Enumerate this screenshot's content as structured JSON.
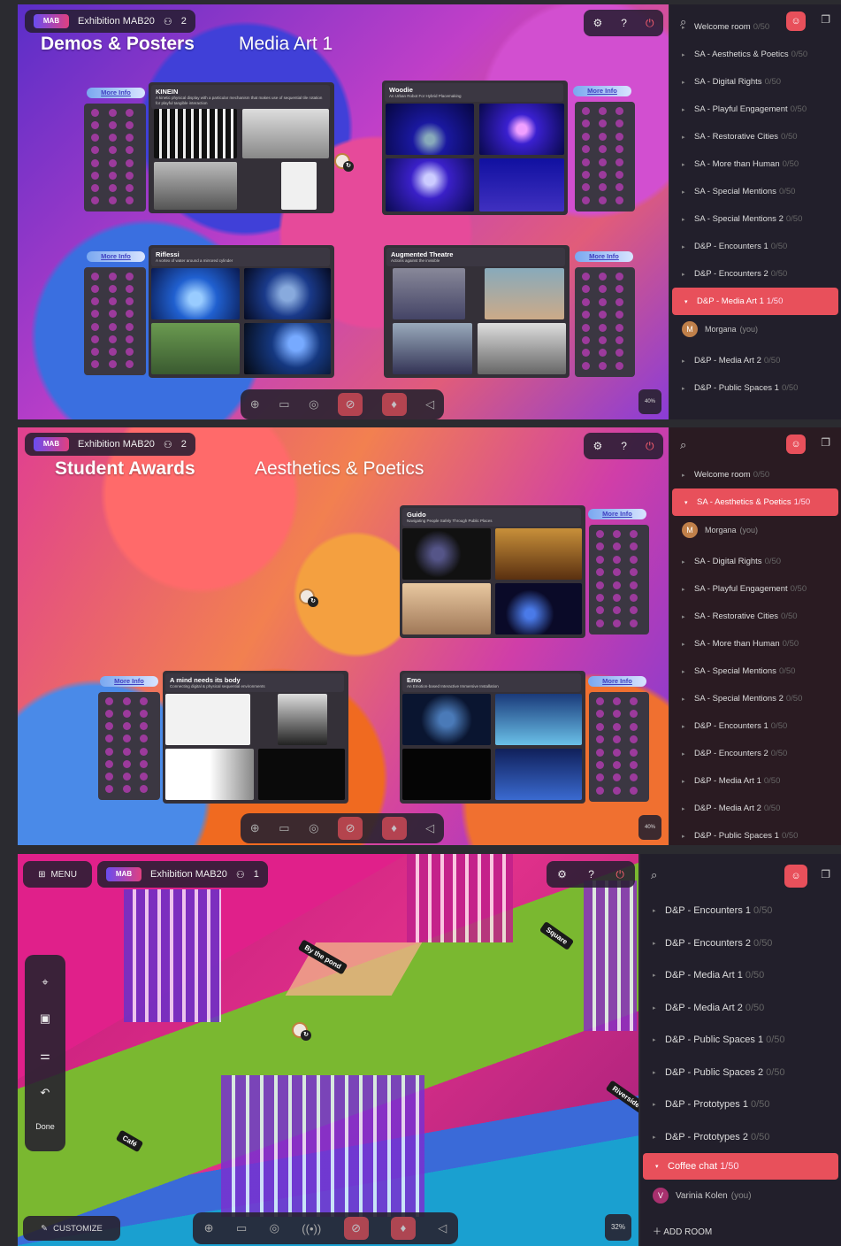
{
  "colors": {
    "accent": "#e8505b",
    "panel": "#221f2b"
  },
  "exhibition": "Exhibition MAB20",
  "logo_text": "MAB",
  "frame1": {
    "users": "2",
    "title": "Demos & Posters",
    "room": "Media Art 1",
    "zoom": "40%",
    "posters": [
      {
        "title": "KINEIN",
        "subtitle": "A kinetic physical display with a particular mechanism that makes use of sequential tile rotation for playful tangible interaction",
        "more": "More Info"
      },
      {
        "title": "Woodie",
        "subtitle": "An Urban Robot For Hybrid Placemaking",
        "more": "More Info"
      },
      {
        "title": "Riflessi",
        "subtitle": "A vortex of water around a mirrored cylinder",
        "more": "More Info"
      },
      {
        "title": "Augmented Theatre",
        "subtitle": "Actions against the invisible",
        "more": "More Info"
      }
    ],
    "rooms": [
      {
        "name": "Welcome room",
        "count": "0/50"
      },
      {
        "name": "SA - Aesthetics & Poetics",
        "count": "0/50"
      },
      {
        "name": "SA - Digital Rights",
        "count": "0/50"
      },
      {
        "name": "SA - Playful Engagement",
        "count": "0/50"
      },
      {
        "name": "SA - Restorative Cities",
        "count": "0/50"
      },
      {
        "name": "SA - More than Human",
        "count": "0/50"
      },
      {
        "name": "SA - Special Mentions",
        "count": "0/50"
      },
      {
        "name": "SA - Special Mentions 2",
        "count": "0/50"
      },
      {
        "name": "D&P - Encounters 1",
        "count": "0/50"
      },
      {
        "name": "D&P - Encounters 2",
        "count": "0/50"
      },
      {
        "name": "D&P - Media Art 1",
        "count": "1/50"
      },
      {
        "name": "D&P - Media Art 2",
        "count": "0/50"
      },
      {
        "name": "D&P - Public Spaces 1",
        "count": "0/50"
      }
    ],
    "user": {
      "initial": "M",
      "name": "Morgana",
      "you": "(you)"
    }
  },
  "frame2": {
    "users": "2",
    "title": "Student Awards",
    "room": "Aesthetics & Poetics",
    "zoom": "40%",
    "posters": [
      {
        "title": "Guido",
        "subtitle": "Navigating People Safely Through Public Places",
        "more": "More Info"
      },
      {
        "title": "A mind needs its body",
        "subtitle": "Connecting digital & physical sequential environments",
        "more": "More Info"
      },
      {
        "title": "Emo",
        "subtitle": "An Emotion-based Interactive Immersive Installation",
        "more": "More Info"
      }
    ],
    "rooms": [
      {
        "name": "Welcome room",
        "count": "0/50"
      },
      {
        "name": "SA - Aesthetics & Poetics",
        "count": "1/50"
      },
      {
        "name": "SA - Digital Rights",
        "count": "0/50"
      },
      {
        "name": "SA - Playful Engagement",
        "count": "0/50"
      },
      {
        "name": "SA - Restorative Cities",
        "count": "0/50"
      },
      {
        "name": "SA - More than Human",
        "count": "0/50"
      },
      {
        "name": "SA - Special Mentions",
        "count": "0/50"
      },
      {
        "name": "SA - Special Mentions 2",
        "count": "0/50"
      },
      {
        "name": "D&P - Encounters 1",
        "count": "0/50"
      },
      {
        "name": "D&P - Encounters 2",
        "count": "0/50"
      },
      {
        "name": "D&P - Media Art 1",
        "count": "0/50"
      },
      {
        "name": "D&P - Media Art 2",
        "count": "0/50"
      },
      {
        "name": "D&P - Public Spaces 1",
        "count": "0/50"
      }
    ],
    "user": {
      "initial": "M",
      "name": "Morgana",
      "you": "(you)"
    }
  },
  "frame3": {
    "users": "1",
    "menu": "MENU",
    "done": "Done",
    "customize": "CUSTOMIZE",
    "zoom": "32%",
    "signs": [
      "By the pond",
      "Square",
      "Café",
      "Riverside"
    ],
    "rooms": [
      {
        "name": "D&P - Encounters 1",
        "count": "0/50"
      },
      {
        "name": "D&P - Encounters 2",
        "count": "0/50"
      },
      {
        "name": "D&P - Media Art 1",
        "count": "0/50"
      },
      {
        "name": "D&P - Media Art 2",
        "count": "0/50"
      },
      {
        "name": "D&P - Public Spaces 1",
        "count": "0/50"
      },
      {
        "name": "D&P - Public Spaces 2",
        "count": "0/50"
      },
      {
        "name": "D&P - Prototypes 1",
        "count": "0/50"
      },
      {
        "name": "D&P - Prototypes 2",
        "count": "0/50"
      },
      {
        "name": "Coffee chat",
        "count": "1/50"
      }
    ],
    "user": {
      "initial": "V",
      "name": "Varinia Kolen",
      "you": "(you)"
    },
    "add_room": "ADD ROOM"
  }
}
